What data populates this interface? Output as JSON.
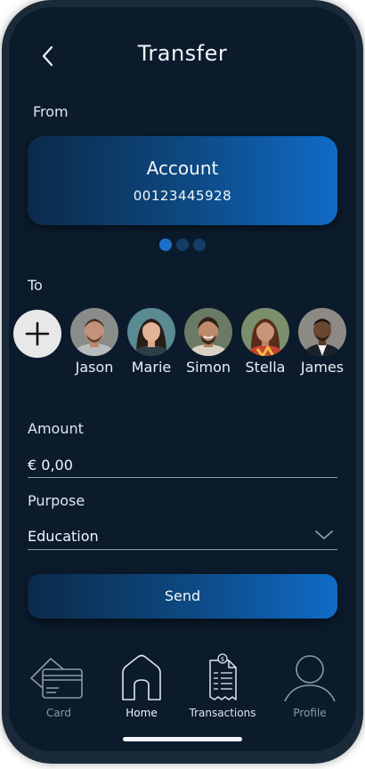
{
  "header": {
    "title": "Transfer"
  },
  "from": {
    "label": "From",
    "account": {
      "title": "Account",
      "number": "00123445928"
    },
    "pager": {
      "count": 3,
      "active_index": 0
    }
  },
  "to": {
    "label": "To",
    "recipients": [
      {
        "name": "Jason"
      },
      {
        "name": "Marie"
      },
      {
        "name": "Simon"
      },
      {
        "name": "Stella"
      },
      {
        "name": "James"
      }
    ]
  },
  "amount": {
    "label": "Amount",
    "value": "€ 0,00"
  },
  "purpose": {
    "label": "Purpose",
    "value": "Education"
  },
  "actions": {
    "send_label": "Send"
  },
  "nav": {
    "items": [
      {
        "label": "Card",
        "icon": "card-icon",
        "active": false
      },
      {
        "label": "Home",
        "icon": "home-icon",
        "active": true
      },
      {
        "label": "Transactions",
        "icon": "receipt-icon",
        "active": true
      },
      {
        "label": "Profile",
        "icon": "profile-icon",
        "active": false
      }
    ]
  },
  "colors": {
    "background": "#0b1b2c",
    "accent": "#106bc8",
    "dot_inactive": "#153c66",
    "nav_inactive": "#8c99a6"
  }
}
